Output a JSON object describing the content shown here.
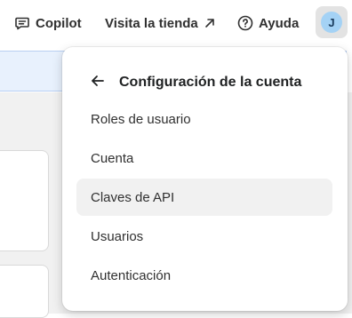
{
  "topbar": {
    "copilot_label": "Copilot",
    "store_label": "Visita la tienda",
    "help_label": "Ayuda",
    "avatar_initial": "J"
  },
  "menu": {
    "title": "Configuración de la cuenta",
    "items": [
      {
        "label": "Roles de usuario"
      },
      {
        "label": "Cuenta"
      },
      {
        "label": "Claves de API"
      },
      {
        "label": "Usuarios"
      },
      {
        "label": "Autenticación"
      }
    ],
    "selected_index": 2
  },
  "colors": {
    "banner_bg": "#e8f1fd",
    "avatar_bg": "#a4d2f5",
    "active_item_bg": "#f1f1f1"
  }
}
